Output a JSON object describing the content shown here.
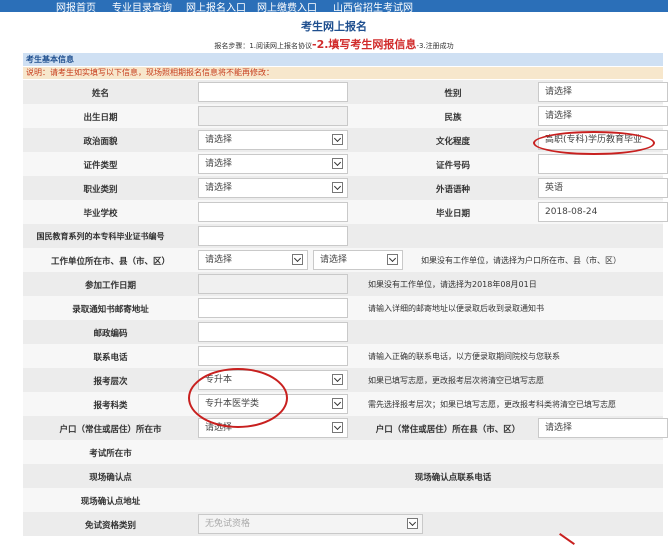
{
  "nav": [
    "网报首页",
    "专业目录查询",
    "网上报名入口",
    "网上缴费入口",
    "山西省招生考试网"
  ],
  "page_title": "考生网上报名",
  "steps": {
    "label": "报名步骤：",
    "s1": "1.阅读网上报名协议",
    "s2": "-2.填写考生网报信息",
    "s3": "-3.注册成功"
  },
  "section_title": "考生基本信息",
  "notice": "说明：请考生如实填写以下信息，现场照相期报名信息将不能再修改：",
  "fields": {
    "name": "姓名",
    "gender": "性别",
    "gender_value": "请选择",
    "birth": "出生日期",
    "ethnicity": "民族",
    "ethnicity_value": "请选择",
    "political": "政治面貌",
    "political_value": "请选择",
    "education": "文化程度",
    "education_value": "高职(专科)学历教育毕业",
    "id_type": "证件类型",
    "id_type_value": "请选择",
    "id_no": "证件号码",
    "occupation": "职业类别",
    "occupation_value": "请选择",
    "language": "外语语种",
    "language_value": "英语",
    "school": "毕业学校",
    "grad_date": "毕业日期",
    "grad_date_value": "2018-08-24",
    "cert_no": "国民教育系列的本专科毕业证书编号",
    "work_loc": "工作单位所在市、县（市、区）",
    "work_loc_city": "请选择",
    "work_loc_county": "请选择",
    "work_loc_hint": "如果没有工作单位，请选择为户口所在市、县（市、区）",
    "work_date": "参加工作日期",
    "work_date_hint": "如果没有工作单位，请选择为2018年08月01日",
    "mail_addr": "录取通知书邮寄地址",
    "mail_addr_hint": "请输入详细的邮寄地址以便录取后收到录取通知书",
    "zip": "邮政编码",
    "phone": "联系电话",
    "phone_hint": "请输入正确的联系电话，以方便录取期间院校与您联系",
    "level": "报考层次",
    "level_value": "专升本",
    "level_hint": "如果已填写志愿，更改报考层次将清空已填写志愿",
    "category": "报考科类",
    "category_value": "专升本医学类",
    "category_hint": "需先选择报考层次；如果已填写志愿，更改报考科类将清空已填写志愿",
    "hukou_city": "户口（常住或居住）所在市",
    "hukou_city_value": "请选择",
    "hukou_county": "户口（常住或居住）所在县（市、区）",
    "hukou_county_value": "请选择",
    "exam_city": "考试所在市",
    "confirm_point": "现场确认点",
    "confirm_phone": "现场确认点联系电话",
    "confirm_addr": "现场确认点地址",
    "exempt": "免试资格类别",
    "exempt_value": "无免试资格"
  }
}
